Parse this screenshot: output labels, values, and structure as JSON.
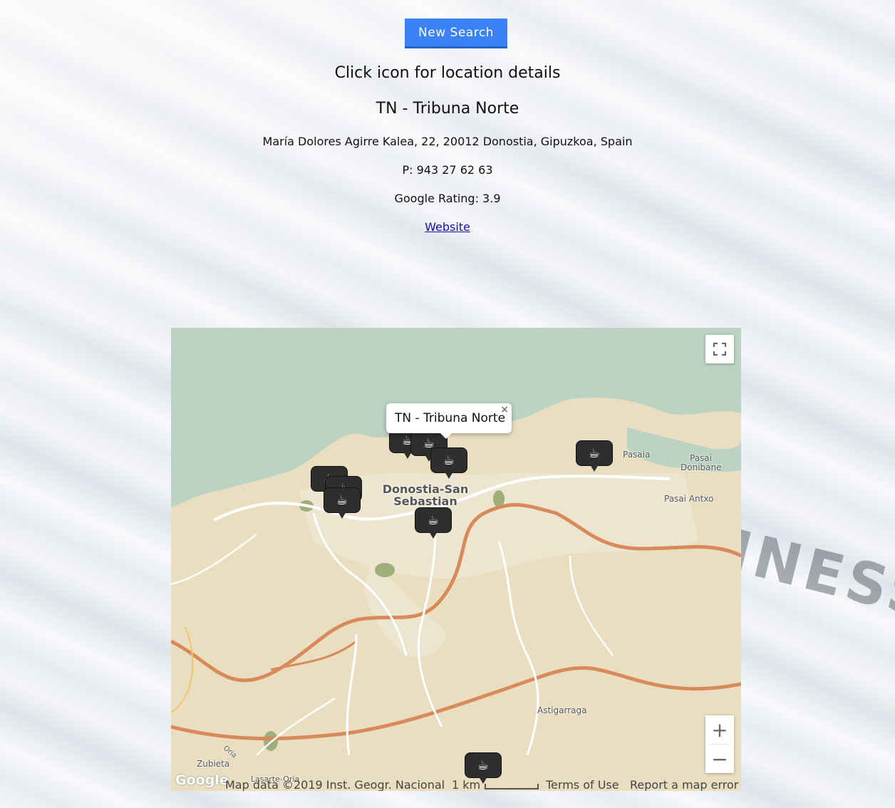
{
  "header": {
    "new_search_label": "New Search",
    "instruction": "Click icon for location details"
  },
  "location": {
    "name": "TN - Tribuna Norte",
    "address": "María Dolores Agirre Kalea, 22, 20012 Donostia, Gipuzkoa, Spain",
    "phone": "P: 943 27 62 63",
    "rating": "Google Rating: 3.9",
    "website_label": "Website"
  },
  "map": {
    "popup_title": "TN - Tribuna Norte",
    "popup_close": "×",
    "fullscreen_icon": "fullscreen-icon",
    "zoom_in": "+",
    "zoom_out": "−",
    "labels": {
      "city_line1": "Donostia-San",
      "city_line2": "Sebastian",
      "pasaia": "Pasaia",
      "pasai_donibane_1": "Pasai",
      "pasai_donibane_2": "Donibane",
      "pasai_antxo": "Pasai Antxo",
      "astigarraga": "Astigarraga",
      "zubieta": "Zubieta",
      "oria": "Oria",
      "lasarte": "Lasarte-Oria"
    },
    "footer": {
      "logo": "Google",
      "map_data": "Map data ©2019 Inst. Geogr. Nacional",
      "scale": "1 km",
      "terms": "Terms of Use",
      "report": "Report a map error"
    },
    "marker_icon": "coffee-cup-icon",
    "colors": {
      "water": "#bcd3c3",
      "land": "#e9dfc0",
      "urban": "#ede5d0",
      "highway": "#d98a5a",
      "road": "#ffffff",
      "park": "#9fae7a",
      "marker": "#2e2e2e",
      "button": "#3b82f6"
    }
  }
}
